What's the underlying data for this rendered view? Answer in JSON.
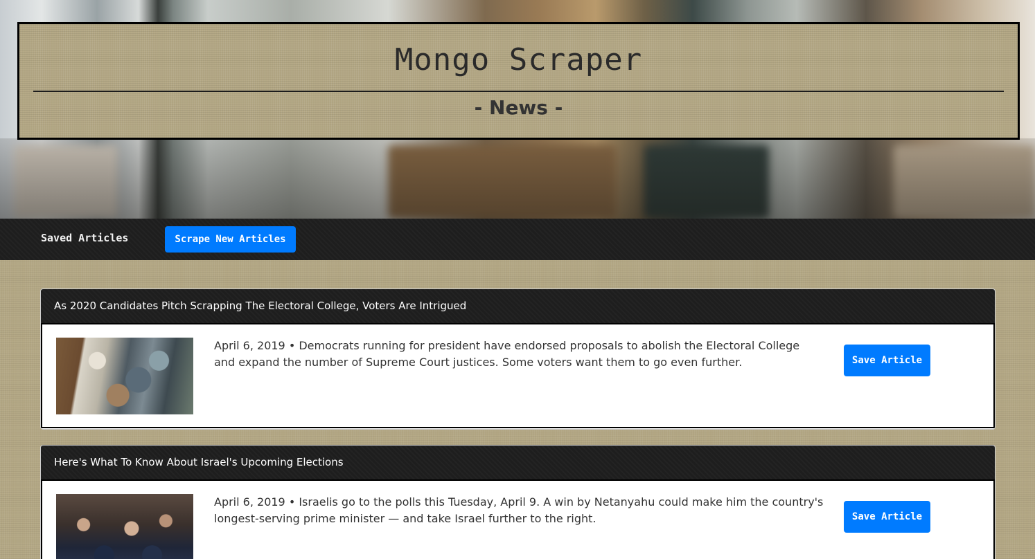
{
  "header": {
    "title": "Mongo Scraper",
    "subtitle": "- News -"
  },
  "nav": {
    "saved_label": "Saved Articles",
    "scrape_label": "Scrape New Articles"
  },
  "articles": [
    {
      "headline": "As 2020 Candidates Pitch Scrapping The Electoral College, Voters Are Intrigued",
      "summary": "April 6, 2019 • Democrats running for president have endorsed proposals to abolish the Electoral College and expand the number of Supreme Court justices. Some voters want them to go even further.",
      "save_label": "Save Article"
    },
    {
      "headline": "Here's What To Know About Israel's Upcoming Elections",
      "summary": "April 6, 2019 • Israelis go to the polls this Tuesday, April 9. A win by Netanyahu could make him the country's longest-serving prime minister — and take Israel further to the right.",
      "save_label": "Save Article"
    }
  ],
  "colors": {
    "accent": "#007bff",
    "navbar": "#1e1e1e",
    "burlap": "#b3a784"
  }
}
